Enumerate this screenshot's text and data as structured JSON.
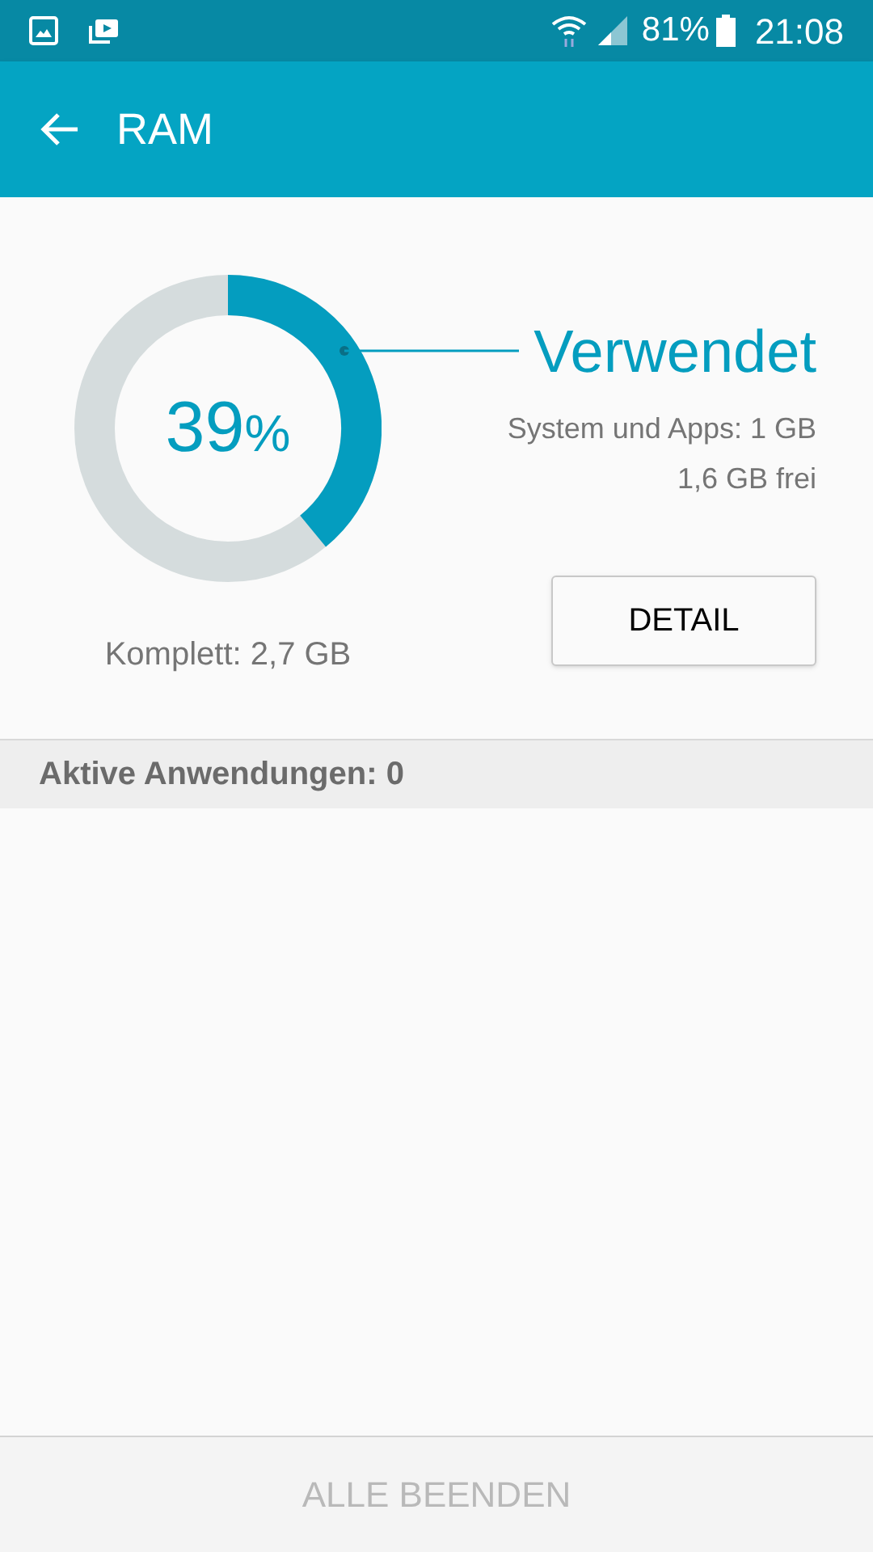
{
  "status_bar": {
    "battery": "81%",
    "time": "21:08"
  },
  "app_bar": {
    "title": "RAM"
  },
  "memory": {
    "percent_value": "39",
    "percent_sign": "%",
    "total": "Komplett: 2,7 GB",
    "used_label": "Verwendet",
    "system_apps": "System und Apps: 1 GB",
    "free": "1,6 GB frei",
    "detail_button": "DETAIL"
  },
  "section_header": "Aktive Anwendungen: 0",
  "bottom_button": {
    "label": "ALLE BEENDEN",
    "disabled": true
  }
}
